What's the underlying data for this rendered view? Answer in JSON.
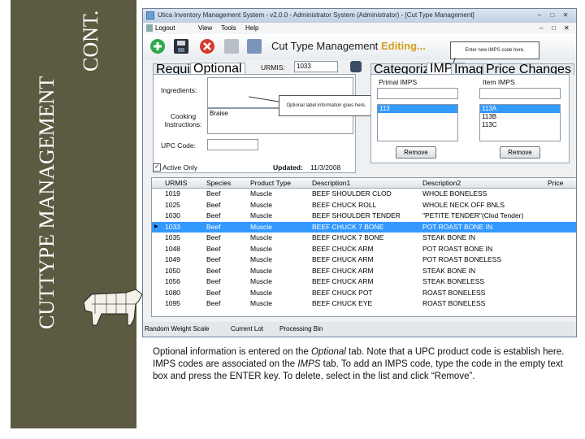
{
  "slide": {
    "title_cut": "CUTTYPE MANAGEMENT",
    "title_cont": "CONT."
  },
  "window": {
    "title": "Utica Inventory Management System - v2.0.0 - Administrator System (Administrator) - [Cut Type Management]",
    "min": "–",
    "max": "□",
    "close": "✕",
    "inner_min": "–",
    "inner_max": "□",
    "inner_close": "✕"
  },
  "menu": [
    "Logout",
    "View",
    "Tools",
    "Help"
  ],
  "toolbar": {
    "title": "Cut Type Management",
    "mode": "Editing..."
  },
  "callouts": {
    "imps": "Enter new IMPS code here.",
    "optional": "Optional label information goes here."
  },
  "left_tabs": [
    "Required",
    "Optional"
  ],
  "urmis": {
    "label": "URMIS:",
    "value": "1033"
  },
  "right_tabs": [
    "Categorization",
    "IMPS",
    "Images",
    "Price Changes"
  ],
  "optional": {
    "ingredients_label": "Ingredients:",
    "cooking_label": "Cooking Instructions:",
    "cooking_value": "Braise",
    "upc_label": "UPC Code:"
  },
  "imps": {
    "primal_label": "Primal IMPS",
    "item_label": "Item IMPS",
    "primal_items": [
      "113"
    ],
    "item_items": [
      "113A",
      "113B",
      "113C"
    ],
    "remove": "Remove"
  },
  "status": {
    "active_label": "Active Only",
    "updated_label": "Updated:",
    "updated_value": "11/3/2008"
  },
  "grid": {
    "columns": [
      "URMIS",
      "Species",
      "Product Type",
      "Description1",
      "Description2",
      "Price"
    ],
    "selected_row": 3,
    "rows": [
      [
        "1019",
        "Beef",
        "Muscle",
        "BEEF SHOULDER CLOD",
        "WHOLE BONELESS"
      ],
      [
        "1025",
        "Beef",
        "Muscle",
        "BEEF CHUCK ROLL",
        "WHOLE NECK OFF BNLS"
      ],
      [
        "1030",
        "Beef",
        "Muscle",
        "BEEF SHOULDER TENDER",
        "\"PETITE TENDER\"(Clod Tender)"
      ],
      [
        "1033",
        "Beef",
        "Muscle",
        "BEEF CHUCK 7 BONE",
        "POT ROAST BONE IN"
      ],
      [
        "1035",
        "Beef",
        "Muscle",
        "BEEF CHUCK 7 BONE",
        "STEAK BONE IN"
      ],
      [
        "1048",
        "Beef",
        "Muscle",
        "BEEF CHUCK ARM",
        "POT ROAST BONE IN"
      ],
      [
        "1049",
        "Beef",
        "Muscle",
        "BEEF CHUCK ARM",
        "POT ROAST BONELESS"
      ],
      [
        "1050",
        "Beef",
        "Muscle",
        "BEEF CHUCK ARM",
        "STEAK BONE IN"
      ],
      [
        "1056",
        "Beef",
        "Muscle",
        "BEEF CHUCK ARM",
        "STEAK BONELESS"
      ],
      [
        "1080",
        "Beef",
        "Muscle",
        "BEEF CHUCK POT",
        "ROAST BONELESS"
      ],
      [
        "1095",
        "Beef",
        "Muscle",
        "BEEF CHUCK EYE",
        "ROAST BONELESS"
      ]
    ]
  },
  "statusbar": [
    "Random Weight Scale",
    "Current Lot",
    "Processing Bin"
  ],
  "caption": {
    "p1": "Optional information is entered on the ",
    "i1": "Optional",
    "p2": " tab. Note that a UPC product code is establish here. IMPS codes are associated on the ",
    "i2": "IMPS",
    "p3": " tab. To add an IMPS code, type the code in the empty text box and press the ENTER key. To delete, select in the list and click “Remove”."
  },
  "colors": {
    "sidebar": "#5c5b42",
    "selection": "#3399ff",
    "editing": "#d4a21f"
  }
}
